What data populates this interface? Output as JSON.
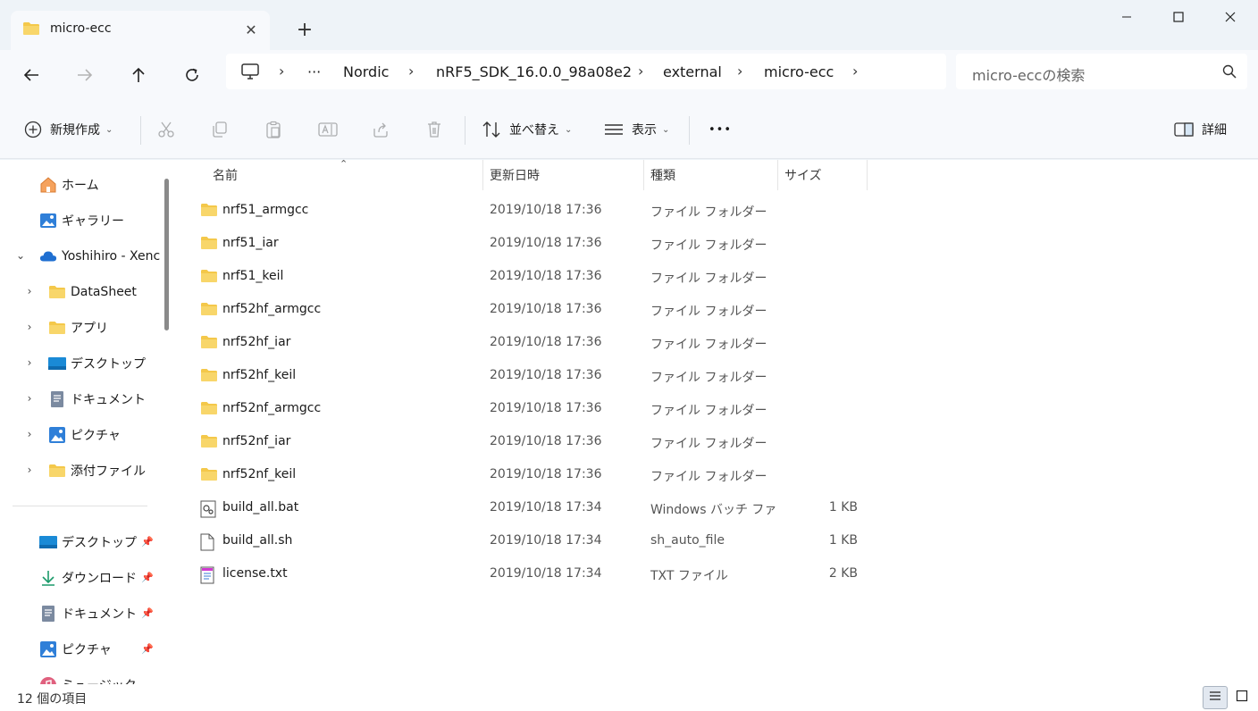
{
  "window": {
    "tab_title": "micro-ecc",
    "tab_close": "✕",
    "new_tab": "+"
  },
  "address": {
    "overflow": "···",
    "crumbs": [
      "Nordic",
      "nRF5_SDK_16.0.0_98a08e2",
      "external",
      "micro-ecc"
    ]
  },
  "search": {
    "placeholder": "micro-eccの検索"
  },
  "commandbar": {
    "new_label": "新規作成",
    "sort_label": "並べ替え",
    "view_label": "表示",
    "more_label": "•••",
    "details_label": "詳細"
  },
  "sidebar": {
    "home": "ホーム",
    "gallery": "ギャラリー",
    "onedrive": "Yoshihiro - Xenc",
    "tree": [
      "DataSheet",
      "アプリ",
      "デスクトップ",
      "ドキュメント",
      "ピクチャ",
      "添付ファイル"
    ],
    "quick": [
      "デスクトップ",
      "ダウンロード",
      "ドキュメント",
      "ピクチャ",
      "ミュージック"
    ]
  },
  "columns": {
    "name": "名前",
    "date": "更新日時",
    "type": "種類",
    "size": "サイズ"
  },
  "files": [
    {
      "name": "nrf51_armgcc",
      "date": "2019/10/18 17:36",
      "type": "ファイル フォルダー",
      "size": "",
      "icon": "folder-icon"
    },
    {
      "name": "nrf51_iar",
      "date": "2019/10/18 17:36",
      "type": "ファイル フォルダー",
      "size": "",
      "icon": "folder-icon"
    },
    {
      "name": "nrf51_keil",
      "date": "2019/10/18 17:36",
      "type": "ファイル フォルダー",
      "size": "",
      "icon": "folder-icon"
    },
    {
      "name": "nrf52hf_armgcc",
      "date": "2019/10/18 17:36",
      "type": "ファイル フォルダー",
      "size": "",
      "icon": "folder-icon"
    },
    {
      "name": "nrf52hf_iar",
      "date": "2019/10/18 17:36",
      "type": "ファイル フォルダー",
      "size": "",
      "icon": "folder-icon"
    },
    {
      "name": "nrf52hf_keil",
      "date": "2019/10/18 17:36",
      "type": "ファイル フォルダー",
      "size": "",
      "icon": "folder-icon"
    },
    {
      "name": "nrf52nf_armgcc",
      "date": "2019/10/18 17:36",
      "type": "ファイル フォルダー",
      "size": "",
      "icon": "folder-icon"
    },
    {
      "name": "nrf52nf_iar",
      "date": "2019/10/18 17:36",
      "type": "ファイル フォルダー",
      "size": "",
      "icon": "folder-icon"
    },
    {
      "name": "nrf52nf_keil",
      "date": "2019/10/18 17:36",
      "type": "ファイル フォルダー",
      "size": "",
      "icon": "folder-icon"
    },
    {
      "name": "build_all.bat",
      "date": "2019/10/18 17:34",
      "type": "Windows バッチ ファ...",
      "size": "1 KB",
      "icon": "batch-file-icon"
    },
    {
      "name": "build_all.sh",
      "date": "2019/10/18 17:34",
      "type": "sh_auto_file",
      "size": "1 KB",
      "icon": "file-icon"
    },
    {
      "name": "license.txt",
      "date": "2019/10/18 17:34",
      "type": "TXT ファイル",
      "size": "2 KB",
      "icon": "text-file-icon"
    }
  ],
  "status": {
    "item_count": "12 個の項目"
  },
  "colors": {
    "folder": "#f4c84a",
    "accent": "#0067c0",
    "chrome": "#eef3f8"
  }
}
